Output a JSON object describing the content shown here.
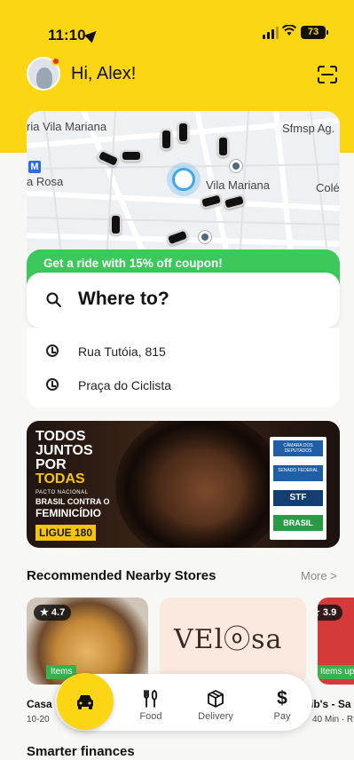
{
  "status_bar": {
    "time": "11:10",
    "battery": "73"
  },
  "header": {
    "greeting": "Hi, Alex!"
  },
  "map": {
    "labels": [
      "ria Vila Mariana",
      "Sfmsp Ag.",
      "a Rosa",
      "Vila Mariana",
      "Colé"
    ],
    "metro_glyph": "M"
  },
  "ride": {
    "coupon": "Get a ride with 15% off coupon!",
    "search_placeholder": "Where to?",
    "recent": [
      "Rua Tutóia, 815",
      "Praça do Ciclista"
    ]
  },
  "promo": {
    "line1": "TODOS",
    "line2": "JUNTOS",
    "line3": "POR",
    "line4": "TODAS",
    "small": "PACTO NACIONAL",
    "mid": "BRASIL CONTRA O",
    "fem": "FEMINICÍDIO",
    "ligue": "LIGUE 180",
    "institutions": [
      "CÂMARA DOS DEPUTADOS",
      "SENADO FEDERAL",
      "STF",
      "BRASIL"
    ]
  },
  "stores": {
    "title": "Recommended Nearby Stores",
    "more": "More >",
    "items": [
      {
        "rating": "★ 4.7",
        "tag": "Items",
        "name": "Casa",
        "sub": "10-20"
      },
      {
        "logo": "VElⓞsa",
        "tag": "",
        "name": "",
        "sub": ""
      },
      {
        "rating": "★ 3.9",
        "tag": "Items up",
        "name": "ib's - Sa",
        "sub": "40 Min · R"
      }
    ]
  },
  "nav": {
    "food": "Food",
    "delivery": "Delivery",
    "pay": "Pay"
  },
  "footer": {
    "section": "Smarter finances"
  }
}
